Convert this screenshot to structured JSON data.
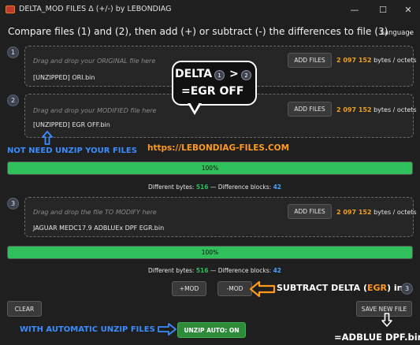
{
  "window": {
    "title": "DELTA_MOD FILES Δ (+/-) by LEBONDIAG",
    "minimize": "—",
    "maximize": "☐",
    "close": "✕"
  },
  "header": {
    "instructions": "Compare files (1) and (2), then add (+) or subtract (-) the differences to file (3)",
    "language_label": "Language",
    "language_caret": "⌄"
  },
  "files": [
    {
      "step": "1",
      "hint": "Drag and drop your ORIGINAL file here",
      "filename": "[UNZIPPED] ORI.bin",
      "add_label": "ADD FILES",
      "size": "2 097 152",
      "size_unit": "bytes / octets"
    },
    {
      "step": "2",
      "hint": "Drag and drop your MODIFIED file here",
      "filename": "[UNZIPPED] EGR OFF.bin",
      "add_label": "ADD FILES",
      "size": "2 097 152",
      "size_unit": "bytes / octets"
    },
    {
      "step": "3",
      "hint": "Drag and drop the file TO MODIFY here",
      "filename": "JAGUAR  MEDC17.9 ADBLUEx DPF EGR.bin",
      "add_label": "ADD FILES",
      "size": "2 097 152",
      "size_unit": "bytes / octets"
    }
  ],
  "progress": [
    {
      "fraction": 1.0,
      "label": "100%"
    },
    {
      "fraction": 1.0,
      "label": "100%"
    }
  ],
  "stats": [
    {
      "prefix": "Different bytes:",
      "bytes": "516",
      "sep": "— Difference blocks:",
      "blocks": "42"
    },
    {
      "prefix": "Different bytes:",
      "bytes": "516",
      "sep": "— Difference blocks:",
      "blocks": "42"
    }
  ],
  "actions": {
    "plus_mod": "+MOD",
    "minus_mod": "-MOD",
    "clear": "CLEAR",
    "save": "SAVE NEW FILE",
    "unzip": "UNZIP AUTO: ON"
  },
  "annotations": {
    "bubble_line1": "DELTA",
    "bubble_badge1": "1",
    "bubble_gt": ">",
    "bubble_badge2": "2",
    "bubble_line2": "=EGR OFF",
    "no_unzip": "NOT NEED UNZIP YOUR FILES",
    "website": "https://LEBONDIAG-FILES.COM",
    "subtract_pre": "SUBTRACT DELTA (",
    "subtract_egr": "EGR",
    "subtract_post": ") in",
    "subtract_badge": "3",
    "auto_unzip": "WITH AUTOMATIC UNZIP FILES",
    "result": "=ADBLUE DPF.bin"
  },
  "colors": {
    "accent_orange": "#ff9a1e",
    "accent_blue": "#3b8cff",
    "progress_green": "#2fbf5b",
    "unzip_green": "#2e8b3a"
  }
}
